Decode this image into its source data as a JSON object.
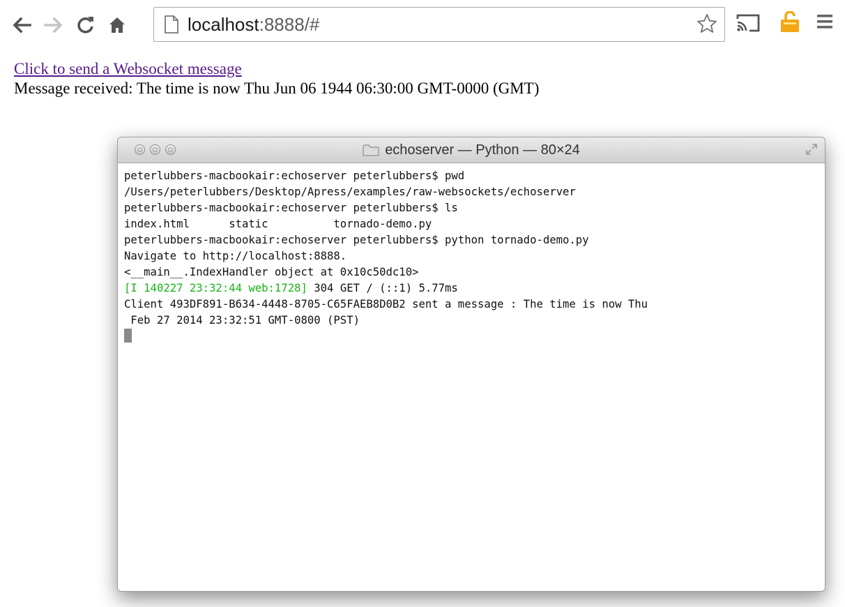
{
  "browser": {
    "url_host": "localhost",
    "url_rest": ":8888/#",
    "icons": {
      "back": "back-arrow-icon",
      "forward": "forward-arrow-icon",
      "reload": "reload-icon",
      "home": "home-icon",
      "page": "page-icon",
      "bookmark": "star-icon",
      "cast": "cast-icon",
      "extension": "extension-icon",
      "menu": "hamburger-menu-icon"
    }
  },
  "page": {
    "link_text": "Click to send a Websocket message",
    "message_text": "Message received: The time is now Thu Jun 06 1944 06:30:00 GMT-0000 (GMT)"
  },
  "terminal": {
    "title": "echoserver — Python — 80×24",
    "lines": [
      "peterlubbers-macbookair:echoserver peterlubbers$ pwd",
      "/Users/peterlubbers/Desktop/Apress/examples/raw-websockets/echoserver",
      "peterlubbers-macbookair:echoserver peterlubbers$ ls",
      "index.html      static          tornado-demo.py",
      "peterlubbers-macbookair:echoserver peterlubbers$ python tornado-demo.py",
      "Navigate to http://localhost:8888.",
      "<__main__.IndexHandler object at 0x10c50dc10>"
    ],
    "log_prefix": "[I 140227 23:32:44 web:1728]",
    "log_rest": " 304 GET / (::1) 5.77ms",
    "lines_after": [
      "Client 493DF891-B634-4448-8705-C65FAEB8D0B2 sent a message : The time is now Thu",
      " Feb 27 2014 23:32:51 GMT-0800 (PST)"
    ]
  },
  "colors": {
    "link": "#551a8b",
    "log_green": "#17b617",
    "extension_icon": "#f3a712"
  }
}
